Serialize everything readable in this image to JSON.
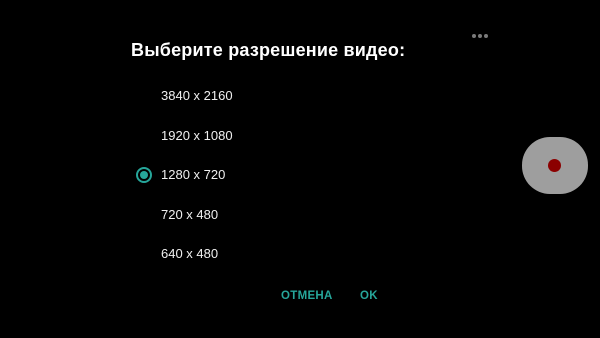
{
  "dialog": {
    "title": "Выберите разрешение видео:",
    "options": [
      {
        "label": "3840 x 2160",
        "selected": false
      },
      {
        "label": "1920 x 1080",
        "selected": false
      },
      {
        "label": "1280 x 720",
        "selected": true
      },
      {
        "label": "720 x 480",
        "selected": false
      },
      {
        "label": "640 x 480",
        "selected": false
      }
    ],
    "cancel_label": "ОТМЕНА",
    "ok_label": "OK"
  },
  "overflow_menu": {
    "icon": "more-horizontal-icon"
  },
  "record_button": {
    "icon": "record-dot-icon"
  },
  "colors": {
    "background": "#000000",
    "accent": "#26a69a",
    "record_button": "#9e9e9e",
    "record_dot": "#8b0000"
  }
}
